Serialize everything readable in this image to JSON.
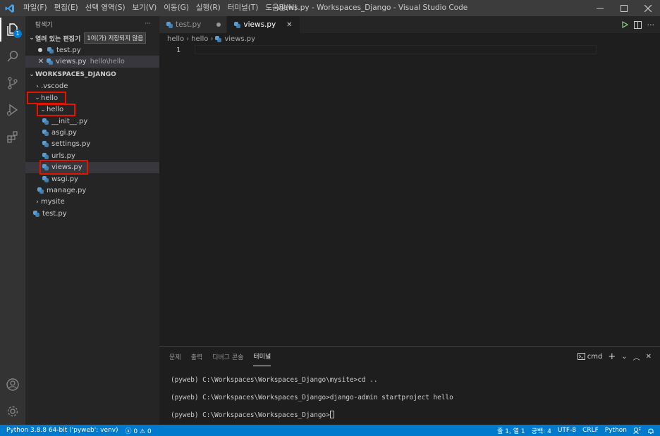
{
  "titlebar": {
    "menu": [
      "파일(F)",
      "편집(E)",
      "선택 영역(S)",
      "보기(V)",
      "이동(G)",
      "실행(R)",
      "터미널(T)",
      "도움말(H)"
    ],
    "title": "views.py - Workspaces_Django - Visual Studio Code"
  },
  "activity": {
    "explorer_badge": "1"
  },
  "sidebar": {
    "header": "탐색기",
    "more": "···",
    "open_editors": {
      "label": "열려 있는 편집기",
      "tooltip": "1이(가) 저장되지 않음"
    },
    "open_items": [
      {
        "name": "test.py",
        "desc": ""
      },
      {
        "name": "views.py",
        "desc": "hello\\hello"
      }
    ],
    "workspace": "WORKSPACES_DJANGO",
    "tree": {
      "vscode": ".vscode",
      "hello_outer": "hello",
      "hello_inner": "hello",
      "init": "__init__.py",
      "asgi": "asgi.py",
      "settings": "settings.py",
      "urls": "urls.py",
      "views": "views.py",
      "wsgi": "wsgi.py",
      "manage": "manage.py",
      "mysite": "mysite",
      "test": "test.py"
    }
  },
  "editor": {
    "tabs": [
      {
        "label": "test.py"
      },
      {
        "label": "views.py"
      }
    ],
    "breadcrumb": [
      "hello",
      "hello",
      "views.py"
    ],
    "line_number": "1"
  },
  "panel": {
    "tabs": [
      "문제",
      "출력",
      "디버그 콘솔",
      "터미널"
    ],
    "terminal_name": "cmd",
    "lines": [
      "(pyweb) C:\\Workspaces\\Workspaces_Django\\mysite>cd ..",
      "(pyweb) C:\\Workspaces\\Workspaces_Django>django-admin startproject hello",
      "(pyweb) C:\\Workspaces\\Workspaces_Django>"
    ]
  },
  "statusbar": {
    "interpreter": "Python 3.8.8 64-bit ('pyweb': venv)",
    "errors": "0",
    "warnings": "0",
    "position": "줄 1, 열 1",
    "spaces": "공백: 4",
    "encoding": "UTF-8",
    "eol": "CRLF",
    "language": "Python"
  },
  "colors": {
    "accent": "#007acc",
    "highlight": "#e51400",
    "background": "#1e1e1e"
  }
}
